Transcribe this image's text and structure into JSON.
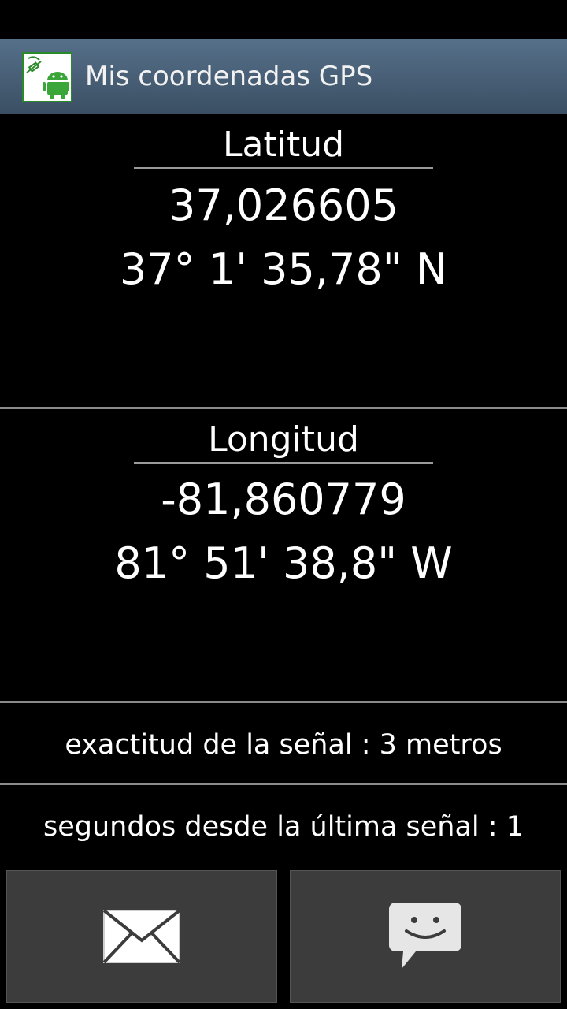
{
  "app": {
    "title": "Mis coordenadas GPS",
    "icon": "gps-android-app-icon"
  },
  "latitude": {
    "label": "Latitud",
    "decimal": "37,026605",
    "dms": "37° 1' 35,78\" N"
  },
  "longitude": {
    "label": "Longitud",
    "decimal": "-81,860779",
    "dms": "81° 51' 38,8\" W"
  },
  "signal": {
    "accuracy_text": "exactitud de la señal : 3 metros",
    "seconds_text": "segundos desde la última señal : 1"
  },
  "buttons": [
    {
      "icon": "email-icon"
    },
    {
      "icon": "sms-icon"
    }
  ],
  "colors": {
    "background": "#000000",
    "action_bar_top": "#56708a",
    "action_bar_bottom": "#3a4f63",
    "button_bg": "#3c3c3c",
    "divider": "#8a8a8a",
    "icon_green": "#2a8a2a"
  }
}
